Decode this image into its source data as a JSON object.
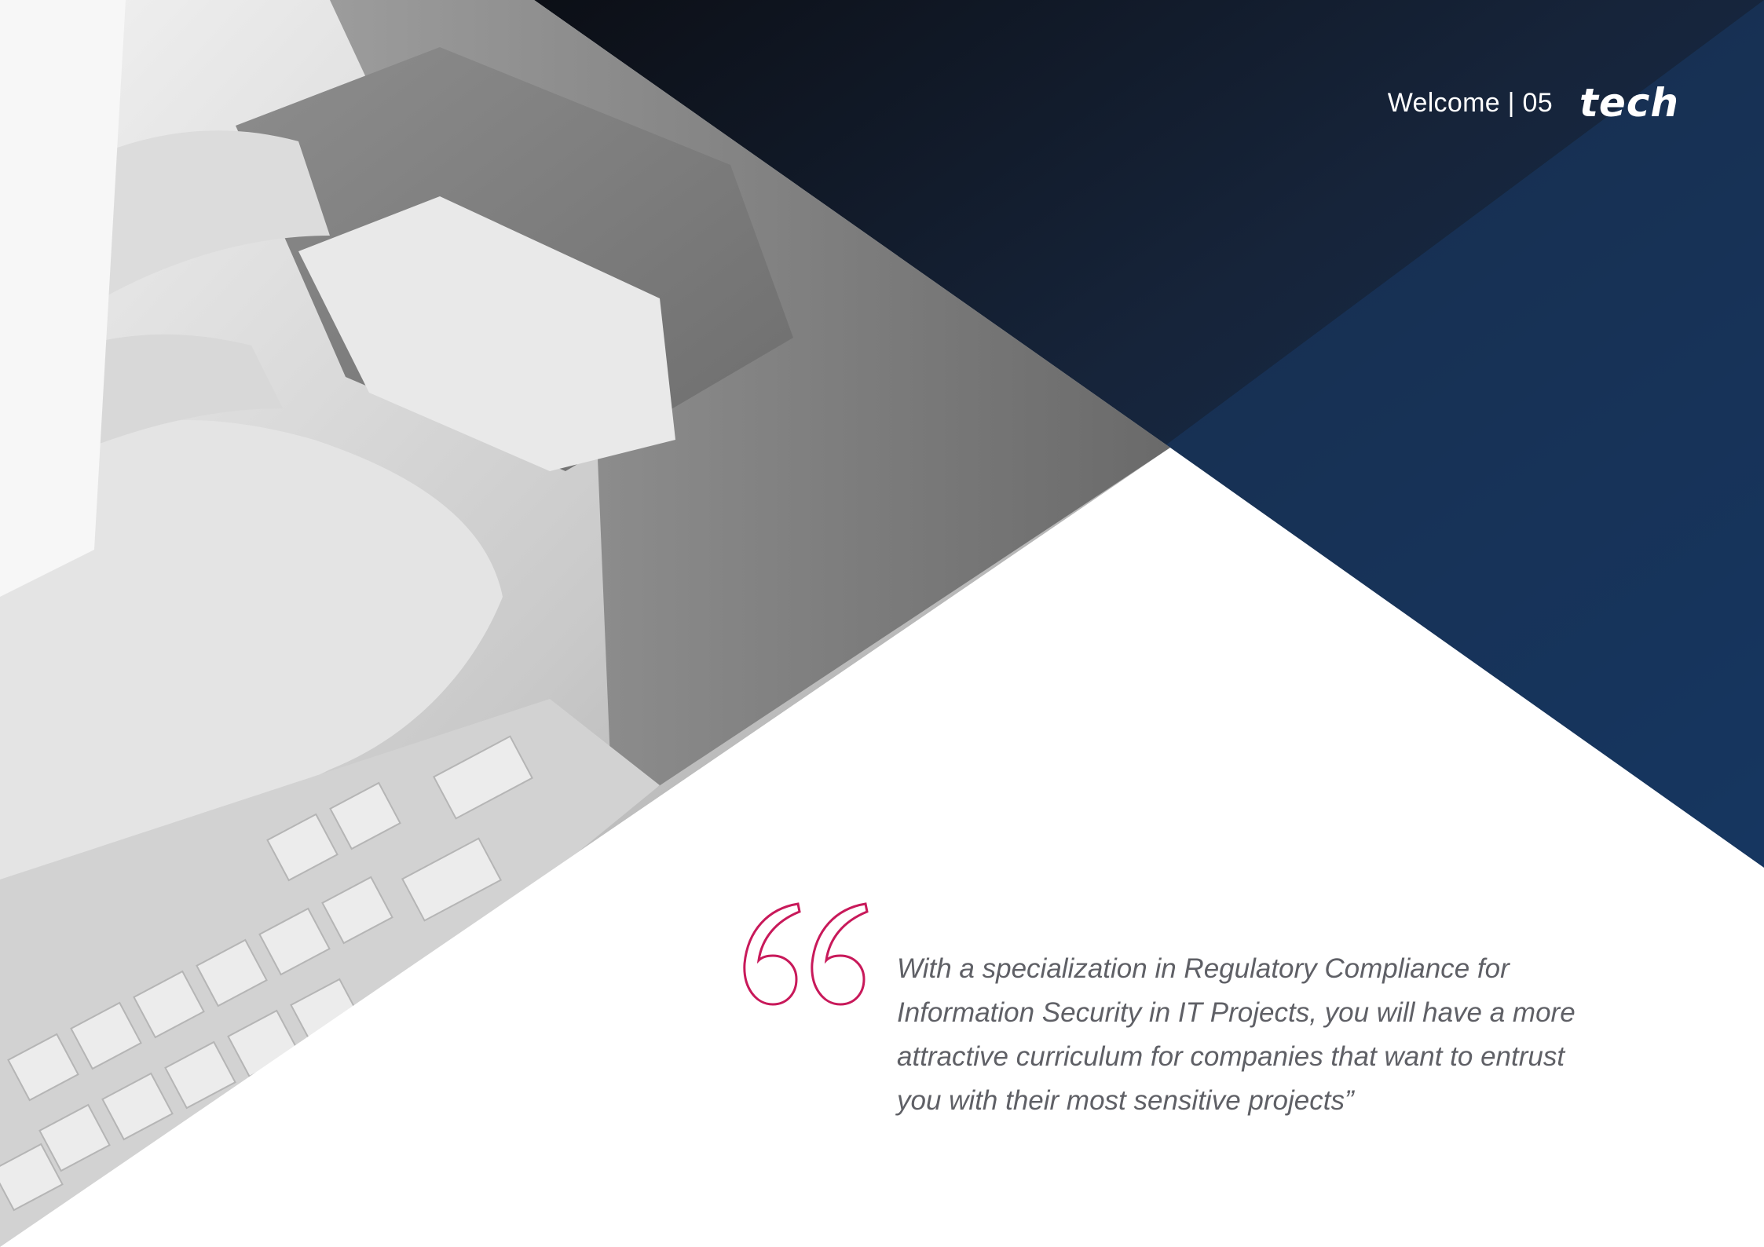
{
  "header": {
    "section_label": "Welcome | 05",
    "logo_text": "tech"
  },
  "quote": {
    "text": "With a specialization in Regulatory Compliance for Information Security in IT Projects, you will have a more attractive curriculum for companies that want to entrust you with their most sensitive projects”",
    "mark_color": "#c8195a"
  },
  "colors": {
    "navy": "#13294b",
    "photo_gray": "#9a9a9a",
    "background": "#ffffff"
  }
}
